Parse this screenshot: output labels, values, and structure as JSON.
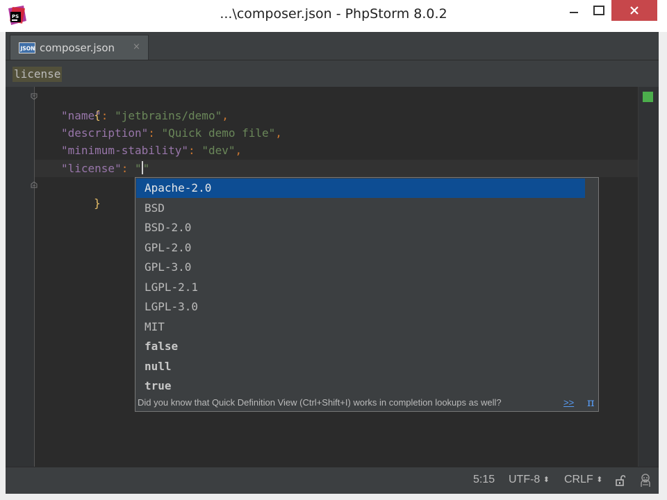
{
  "window": {
    "title": "...\\composer.json - PhpStorm 8.0.2"
  },
  "tabs": [
    {
      "label": "composer.json",
      "close": "×",
      "icon": "json-file-icon",
      "icon_text": "JSON"
    }
  ],
  "breadcrumb": "license",
  "editor": {
    "lines": [
      {
        "key": "\"name\"",
        "value": "\"jetbrains/demo\"",
        "trail": ","
      },
      {
        "key": "\"description\"",
        "value": "\"Quick demo file\"",
        "trail": ","
      },
      {
        "key": "\"minimum-stability\"",
        "value": "\"dev\"",
        "trail": ","
      },
      {
        "key": "\"license\"",
        "value_open": "\"",
        "value_close": "\""
      }
    ],
    "open_brace": "{",
    "close_brace": "}",
    "colon": ":"
  },
  "completion": {
    "items": [
      {
        "label": "Apache-2.0",
        "selected": true
      },
      {
        "label": "BSD"
      },
      {
        "label": "BSD-2.0"
      },
      {
        "label": "GPL-2.0"
      },
      {
        "label": "GPL-3.0"
      },
      {
        "label": "LGPL-2.1"
      },
      {
        "label": "LGPL-3.0"
      },
      {
        "label": "MIT"
      },
      {
        "label": "false",
        "bold": true
      },
      {
        "label": "null",
        "bold": true
      },
      {
        "label": "true",
        "bold": true
      }
    ],
    "hint": "Did you know that Quick Definition View (Ctrl+Shift+I) works in completion lookups as well?",
    "hint_link": ">>",
    "pi": "π"
  },
  "status": {
    "position": "5:15",
    "encoding": "UTF-8",
    "line_separator": "CRLF",
    "updown": "⬍"
  },
  "colors": {
    "selection": "#0d4d93",
    "editor_bg": "#2b2b2b",
    "keyword": "#9876aa",
    "string": "#6a8759",
    "close_button": "#c7474b"
  }
}
